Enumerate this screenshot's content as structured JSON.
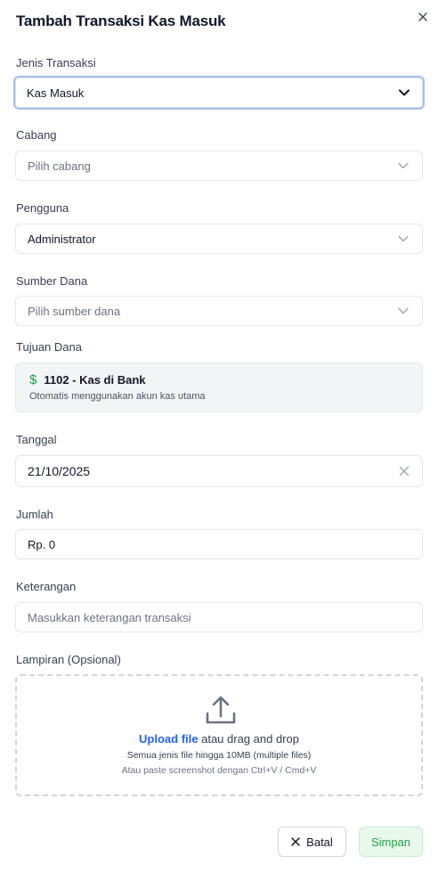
{
  "dialog": {
    "title": "Tambah Transaksi Kas Masuk"
  },
  "fields": {
    "jenis": {
      "label": "Jenis Transaksi",
      "value": "Kas Masuk"
    },
    "cabang": {
      "label": "Cabang",
      "placeholder": "Pilih cabang"
    },
    "pengguna": {
      "label": "Pengguna",
      "value": "Administrator"
    },
    "sumber": {
      "label": "Sumber Dana",
      "placeholder": "Pilih sumber dana"
    },
    "tujuan": {
      "label": "Tujuan Dana",
      "account": "1102 - Kas di Bank",
      "hint": "Otomatis menggunakan akun kas utama",
      "currency_symbol": "$"
    },
    "tanggal": {
      "label": "Tanggal",
      "value": "21/10/2025"
    },
    "jumlah": {
      "label": "Jumlah",
      "value": "Rp. 0"
    },
    "keterangan": {
      "label": "Keterangan",
      "placeholder": "Masukkan keterangan transaksi"
    },
    "lampiran": {
      "label": "Lampiran (Opsional)",
      "upload_link": "Upload file",
      "drag_text": " atau drag and drop",
      "limits": "Semua jenis file hingga 10MB (multiple files)",
      "paste_hint": "Atau paste screenshot dengan Ctrl+V / Cmd+V"
    }
  },
  "actions": {
    "cancel": "Batal",
    "save": "Simpan"
  },
  "icons": {
    "close": "close-icon",
    "dropdown": "chevron-down-icon",
    "dollar": "dollar-icon",
    "clear": "clear-icon",
    "upload": "upload-icon"
  },
  "colors": {
    "accent_link": "#2563eb",
    "save_text": "#22a34a",
    "save_bg": "#e8f8ec",
    "focus_ring": "#a9bfe8",
    "currency_icon": "#16a34a"
  }
}
